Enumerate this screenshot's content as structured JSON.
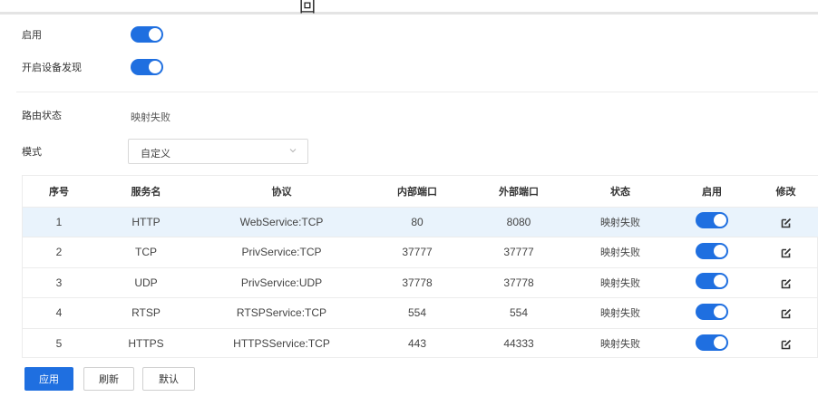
{
  "top_fragment": "回",
  "settings": {
    "enable_label": "启用",
    "discovery_label": "开启设备发现",
    "route_status_label": "路由状态",
    "route_status_value": "映射失败",
    "mode_label": "模式",
    "mode_value": "自定义"
  },
  "table": {
    "headers": {
      "index": "序号",
      "service": "服务名",
      "protocol": "协议",
      "internal_port": "内部端口",
      "external_port": "外部端口",
      "status": "状态",
      "enable": "启用",
      "edit": "修改"
    },
    "rows": [
      {
        "index": "1",
        "service": "HTTP",
        "protocol": "WebService:TCP",
        "internal_port": "80",
        "external_port": "8080",
        "status": "映射失败",
        "enabled": true
      },
      {
        "index": "2",
        "service": "TCP",
        "protocol": "PrivService:TCP",
        "internal_port": "37777",
        "external_port": "37777",
        "status": "映射失败",
        "enabled": true
      },
      {
        "index": "3",
        "service": "UDP",
        "protocol": "PrivService:UDP",
        "internal_port": "37778",
        "external_port": "37778",
        "status": "映射失败",
        "enabled": true
      },
      {
        "index": "4",
        "service": "RTSP",
        "protocol": "RTSPService:TCP",
        "internal_port": "554",
        "external_port": "554",
        "status": "映射失败",
        "enabled": true
      },
      {
        "index": "5",
        "service": "HTTPS",
        "protocol": "HTTPSService:TCP",
        "internal_port": "443",
        "external_port": "44333",
        "status": "映射失败",
        "enabled": true
      }
    ]
  },
  "buttons": {
    "apply": "应用",
    "refresh": "刷新",
    "default": "默认"
  },
  "colors": {
    "accent": "#1f6fe0",
    "row_highlight": "#e9f3fc"
  }
}
